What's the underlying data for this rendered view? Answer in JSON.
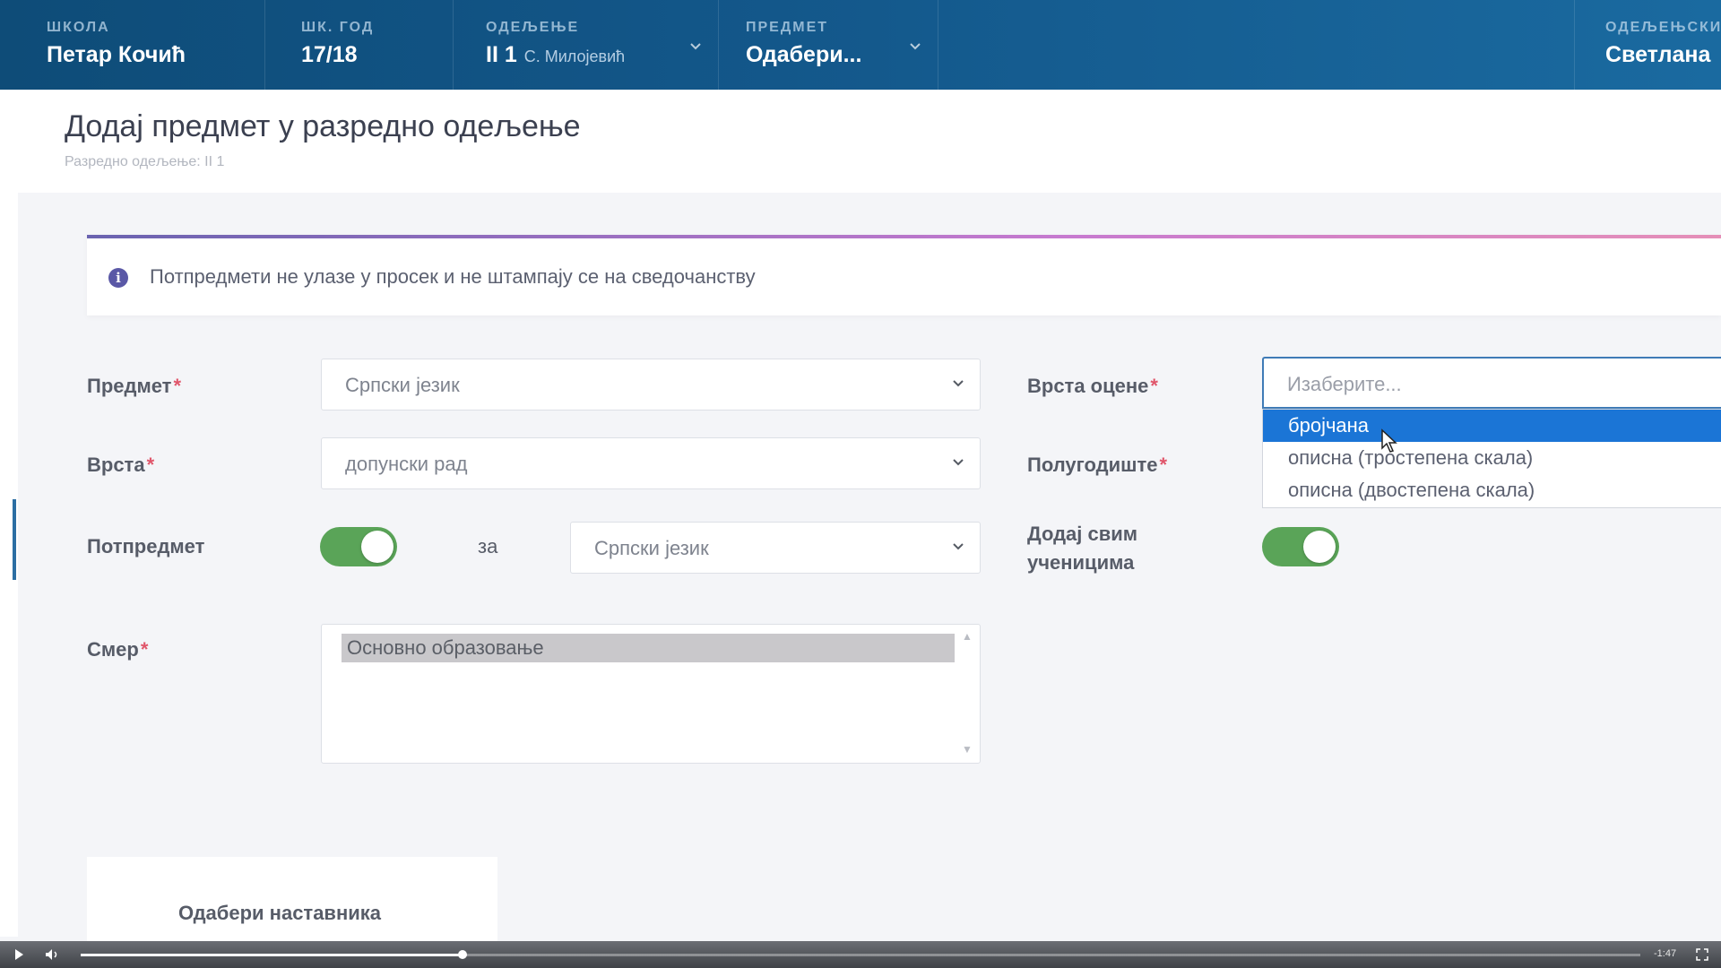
{
  "header": {
    "school": {
      "label": "Школа",
      "value": "Петар Кочић"
    },
    "year": {
      "label": "Шк. год",
      "value": "17/18"
    },
    "department": {
      "label": "Одељење",
      "value": "II 1",
      "teacher": "С. Милојевић"
    },
    "subject": {
      "label": "Предмет",
      "value": "Одабери..."
    },
    "class_teacher": {
      "label": "Одељењски",
      "value": "Светлана"
    }
  },
  "page": {
    "title": "Додај предмет у разредно одељење",
    "subtitle": "Разредно одељење: II 1"
  },
  "info": {
    "icon": "info-icon",
    "text": "Потпредмети не улазе у просек и не штампају се на сведочанству"
  },
  "form": {
    "subject": {
      "label": "Предмет",
      "value": "Српски језик"
    },
    "type": {
      "label": "Врста",
      "value": "допунски рад"
    },
    "subsubject": {
      "label": "Потпредмет",
      "for_label": "за",
      "parent_value": "Српски језик",
      "enabled": true
    },
    "direction": {
      "label": "Смер",
      "options": [
        "Основно образовање"
      ]
    },
    "grade_type": {
      "label": "Врста оцене",
      "placeholder": "Изаберите...",
      "options": [
        "бројчана",
        "описна (тростепена скала)",
        "описна (двостепена скала)"
      ],
      "highlighted": "бројчана"
    },
    "semester": {
      "label": "Полугодиште"
    },
    "add_all": {
      "label_line1": "Додај свим",
      "label_line2": "ученицима",
      "enabled": true
    },
    "required_mark": "*"
  },
  "teacher_card": {
    "label": "Одабери наставника"
  },
  "player": {
    "time": "-1:47",
    "progress": 0.245
  }
}
